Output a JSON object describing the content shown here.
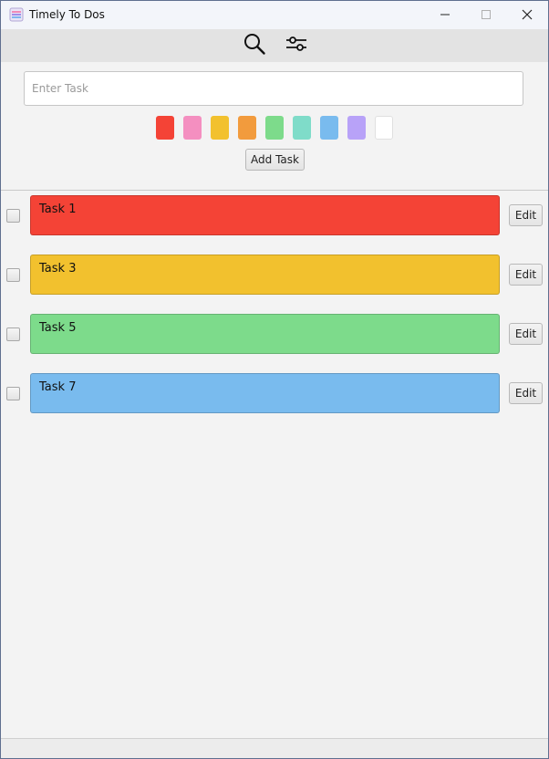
{
  "window": {
    "title": "Timely To Dos",
    "icons": {
      "app": "notepad-lines-icon",
      "minimize": "minimize-icon",
      "maximize": "maximize-icon",
      "close": "close-icon"
    }
  },
  "toolbar": {
    "icons": {
      "search": "search-icon",
      "filter": "sliders-icon"
    }
  },
  "entry": {
    "placeholder": "Enter Task",
    "value": "",
    "add_label": "Add Task",
    "colors": [
      {
        "name": "red",
        "hex": "#f44336"
      },
      {
        "name": "pink",
        "hex": "#f48fc0"
      },
      {
        "name": "yellow",
        "hex": "#f2c12e"
      },
      {
        "name": "orange",
        "hex": "#f29b3d"
      },
      {
        "name": "green",
        "hex": "#7ddb8b"
      },
      {
        "name": "teal",
        "hex": "#7fdcc9"
      },
      {
        "name": "blue",
        "hex": "#79bbee"
      },
      {
        "name": "purple",
        "hex": "#b8a2f8"
      },
      {
        "name": "white",
        "hex": "#ffffff"
      }
    ]
  },
  "tasks": [
    {
      "label": "Task 1",
      "color": "#f44336",
      "checked": false,
      "edit_label": "Edit"
    },
    {
      "label": "Task 3",
      "color": "#f2c12e",
      "checked": false,
      "edit_label": "Edit"
    },
    {
      "label": "Task 5",
      "color": "#7ddb8b",
      "checked": false,
      "edit_label": "Edit"
    },
    {
      "label": "Task 7",
      "color": "#79bbee",
      "checked": false,
      "edit_label": "Edit"
    }
  ]
}
